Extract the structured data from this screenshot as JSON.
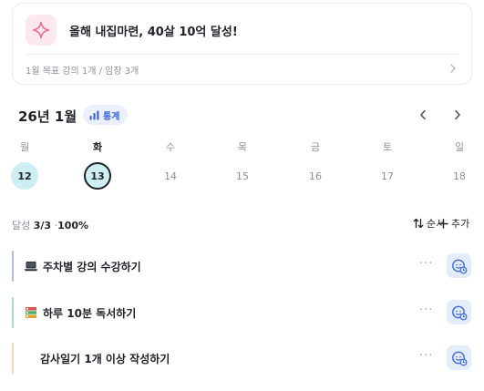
{
  "goal": {
    "title": "올해 내집마련, 40살 10억 달성!",
    "subtitle": "1월 목표  강의 1개 / 임장 3개",
    "icon": "sparkle-icon",
    "accent": "#f06a93"
  },
  "calendar": {
    "month_label": "26년 1월",
    "stats_label": "통계",
    "weekdays": [
      "월",
      "화",
      "수",
      "목",
      "금",
      "토",
      "일"
    ],
    "days": [
      "12",
      "13",
      "14",
      "15",
      "16",
      "17",
      "18"
    ],
    "today": "13",
    "highlight_color": "#cdeef3"
  },
  "summary": {
    "prefix": "달성",
    "count": "3/3",
    "separator": "·",
    "percent": "100%",
    "order_label": "순서",
    "add_label": "추가"
  },
  "tasks": [
    {
      "emoji": "laptop-icon",
      "label": "주차별 강의 수강하기",
      "bar_color": "#a9c0ee"
    },
    {
      "emoji": "books-icon",
      "label": "하루 10분 독서하기",
      "bar_color": "#a8dcc6"
    },
    {
      "emoji": "",
      "label": "감사일기 1개 이상 작성하기",
      "bar_color": "#f6d8b3"
    }
  ],
  "colors": {
    "task_action_bg": "#e3ecfb",
    "task_action_icon": "#3b66d8"
  }
}
